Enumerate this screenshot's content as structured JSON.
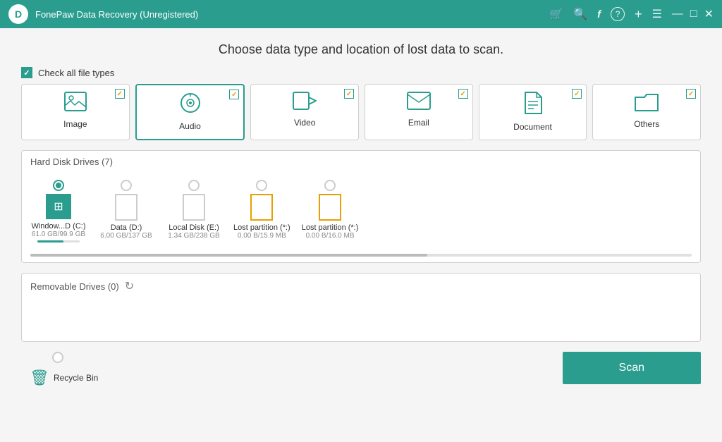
{
  "app": {
    "title": "FonePaw Data Recovery (Unregistered)"
  },
  "titlebar": {
    "icons": [
      "🛒",
      "🔍",
      "f",
      "?",
      "+",
      "☰",
      "—",
      "□",
      "✕"
    ]
  },
  "page": {
    "title": "Choose data type and location of lost data to scan."
  },
  "fileTypes": {
    "checkAllLabel": "Check all file types",
    "items": [
      {
        "id": "image",
        "label": "Image",
        "selected": false,
        "checked": true,
        "icon": "image"
      },
      {
        "id": "audio",
        "label": "Audio",
        "selected": true,
        "checked": true,
        "icon": "audio"
      },
      {
        "id": "video",
        "label": "Video",
        "selected": false,
        "checked": true,
        "icon": "video"
      },
      {
        "id": "email",
        "label": "Email",
        "selected": false,
        "checked": true,
        "icon": "email"
      },
      {
        "id": "document",
        "label": "Document",
        "selected": false,
        "checked": true,
        "icon": "document"
      },
      {
        "id": "others",
        "label": "Others",
        "selected": false,
        "checked": true,
        "icon": "others"
      }
    ]
  },
  "hardDiskDrives": {
    "label": "Hard Disk Drives (7)",
    "drives": [
      {
        "id": "c",
        "name": "Window...D (C:)",
        "size": "61.0 GB/99.9 GB",
        "selected": true,
        "type": "windows",
        "progress": 61
      },
      {
        "id": "d",
        "name": "Data (D:)",
        "size": "6.00 GB/137 GB",
        "selected": false,
        "type": "box",
        "progress": 0
      },
      {
        "id": "e",
        "name": "Local Disk (E:)",
        "size": "1.34 GB/238 GB",
        "selected": false,
        "type": "box",
        "progress": 0
      },
      {
        "id": "lost1",
        "name": "Lost partition (*:)",
        "size": "0.00 B/15.9 MB",
        "selected": false,
        "type": "box-orange",
        "progress": 0
      },
      {
        "id": "lost2",
        "name": "Lost partition (*:)",
        "size": "0.00 B/16.0 MB",
        "selected": false,
        "type": "box-orange",
        "progress": 0
      }
    ]
  },
  "removableDrives": {
    "label": "Removable Drives (0)"
  },
  "recycleBin": {
    "label": "Recycle Bin"
  },
  "scanButton": {
    "label": "Scan"
  }
}
